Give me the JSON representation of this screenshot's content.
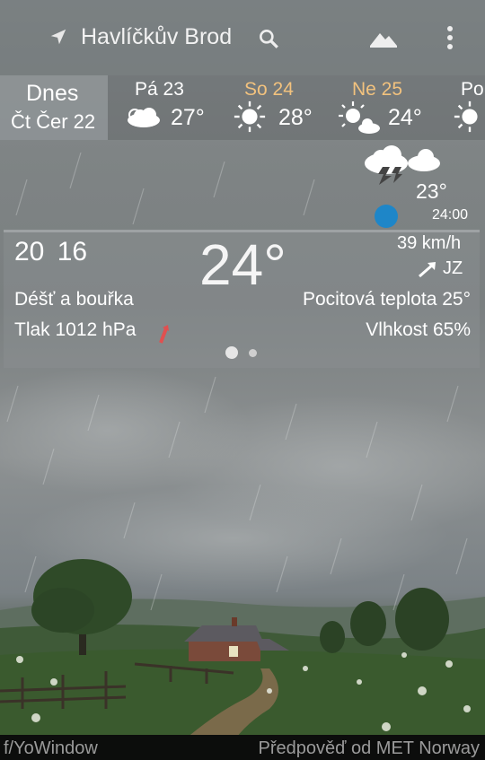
{
  "header": {
    "city": "Havlíčkův Brod"
  },
  "forecast_days": [
    {
      "name": "Dnes",
      "date": "Čt Čer 22",
      "temp": ""
    },
    {
      "name": "Pá 23",
      "temp": "27°"
    },
    {
      "name": "So 24",
      "temp": "28°"
    },
    {
      "name": "Ne 25",
      "temp": "24°"
    },
    {
      "name": "Po",
      "temp": ""
    }
  ],
  "hourly": {
    "temp": "23°",
    "time": "24:00"
  },
  "current": {
    "high": "20",
    "low": "16",
    "temp": "24°",
    "wind_speed": "39 km/h",
    "wind_dir": "JZ",
    "condition": "Déšť a bouřka",
    "feels_like": "Pocitová teplota 25°",
    "pressure": "Tlak 1012 hPa",
    "humidity": "Vlhkost 65%"
  },
  "footer": {
    "left": "f/YoWindow",
    "right": "Předpověď od MET Norway"
  },
  "colors": {
    "weekend": "#f2c27e",
    "accent_dot": "#1e86c8",
    "pressure_trend": "#e05050"
  }
}
